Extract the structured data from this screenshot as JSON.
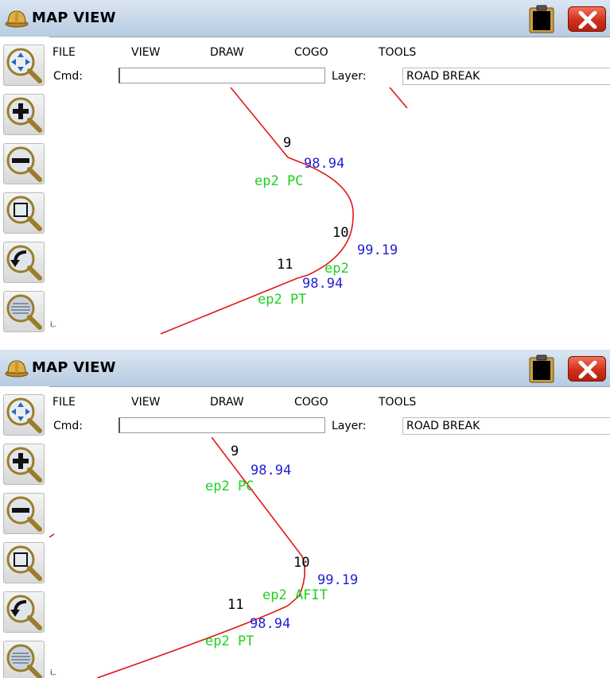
{
  "panels": [
    {
      "title": "MAP VIEW",
      "menu": [
        "FILE",
        "VIEW",
        "DRAW",
        "COGO",
        "TOOLS"
      ],
      "cmd_label": "Cmd:",
      "cmd_value": "",
      "layer_label": "Layer:",
      "layer_value": "ROAD BREAK",
      "points": {
        "p9": {
          "number": "9",
          "elevation": "98.94",
          "description": "ep2 PC"
        },
        "p10": {
          "number": "10",
          "elevation": "99.19",
          "description": "ep2"
        },
        "p11": {
          "number": "11",
          "elevation": "98.94",
          "description": "ep2 PT"
        }
      },
      "corner_glyph": "i,."
    },
    {
      "title": "MAP VIEW",
      "menu": [
        "FILE",
        "VIEW",
        "DRAW",
        "COGO",
        "TOOLS"
      ],
      "cmd_label": "Cmd:",
      "cmd_value": "",
      "layer_label": "Layer:",
      "layer_value": "ROAD BREAK",
      "points": {
        "p9": {
          "number": "9",
          "elevation": "98.94",
          "description": "ep2 PC"
        },
        "p10": {
          "number": "10",
          "elevation": "99.19",
          "description": "ep2 AFIT"
        },
        "p11": {
          "number": "11",
          "elevation": "98.94",
          "description": "ep2 PT"
        }
      },
      "corner_glyph": "i,."
    }
  ],
  "toolbar_icons": [
    "zoom-pan-icon",
    "zoom-in-icon",
    "zoom-out-icon",
    "zoom-window-icon",
    "zoom-previous-icon",
    "zoom-extents-icon"
  ],
  "colors": {
    "linework": "#e01818",
    "point_number": "#000000",
    "elevation": "#1f1fd6",
    "description": "#20d020",
    "title_bar": "#c8d8ea",
    "close_button": "#d0301b"
  }
}
